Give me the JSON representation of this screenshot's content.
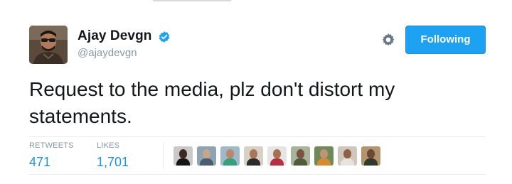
{
  "user": {
    "name": "Ajay Devgn",
    "handle": "@ajaydevgn",
    "verified": true
  },
  "actions": {
    "follow_label": "Following"
  },
  "tweet": {
    "text": "Request to the media, plz don't distort my statements."
  },
  "stats": {
    "retweets_label": "RETWEETS",
    "retweets_count": "471",
    "likes_label": "LIKES",
    "likes_count": "1,701"
  },
  "colors": {
    "accent": "#1da1f2",
    "count": "#1b95e0",
    "muted": "#8899a6",
    "divider": "#e6ecf0"
  },
  "likers_count_shown": 9
}
